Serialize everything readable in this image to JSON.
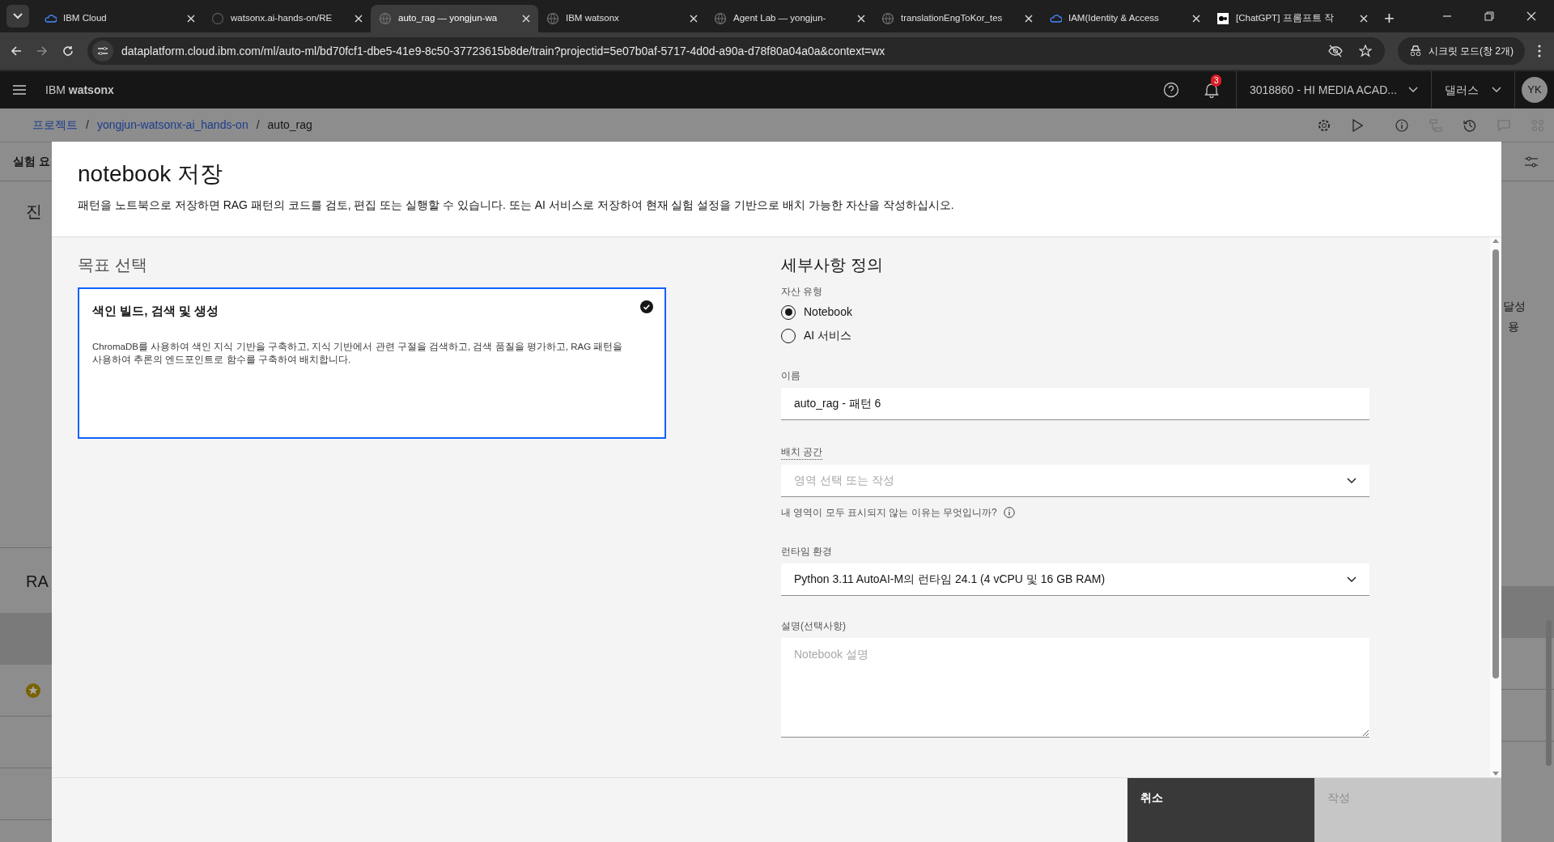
{
  "browser": {
    "tabs": [
      {
        "title": "IBM Cloud",
        "selected": false
      },
      {
        "title": "watsonx.ai-hands-on/RE",
        "selected": false
      },
      {
        "title": "auto_rag — yongjun-wa",
        "selected": true
      },
      {
        "title": "IBM watsonx",
        "selected": false
      },
      {
        "title": "Agent Lab — yongjun-",
        "selected": false
      },
      {
        "title": "translationEngToKor_tes",
        "selected": false
      },
      {
        "title": "IAM(Identity & Access",
        "selected": false
      },
      {
        "title": "[ChatGPT] 프롬프트 작",
        "selected": false
      }
    ],
    "new_tab": "+",
    "url": "dataplatform.cloud.ibm.com/ml/auto-ml/bd70fcf1-dbe5-41e9-8c50-37723615b8de/train?projectid=5e07b0af-5717-4d0d-a90a-d78f80a04a0a&context=wx",
    "profile": "시크릿 모드(창 2개)"
  },
  "app_header": {
    "brand": "IBM **watsonx**",
    "notification_count": "3",
    "account": "3018860 - HI MEDIA ACAD...",
    "region": "댈러스",
    "avatar": "YK"
  },
  "breadcrumb": {
    "items": [
      {
        "label": "프로젝트",
        "link": true
      },
      {
        "label": "yongjun-watsonx-ai_hands-on",
        "link": true
      },
      {
        "label": "auto_rag",
        "link": false
      }
    ],
    "separators": [
      "/",
      "/"
    ]
  },
  "background_page": {
    "left_texts": [
      "실험 요",
      "진",
      "RA"
    ],
    "right_texts": [
      "달성",
      "용"
    ]
  },
  "modal": {
    "title": "notebook 저장",
    "description": "패턴을 노트북으로 저장하면 RAG 패턴의 코드를 검토, 편집 또는 실행할 수 있습니다. 또는 AI 서비스로 저장하여 현재 실험 설정을 기반으로 배치 가능한 자산을 작성하십시오.",
    "goal_section": {
      "title": "목표 선택",
      "cards": [
        {
          "title": "색인 빌드, 검색 및 생성",
          "description": "ChromaDB를 사용하여 색인 지식 기반을 구축하고, 지식 기반에서 관련 구절을 검색하고, 검색 품질을 평가하고, RAG 패턴을 사용하여 추론의 엔드포인트로 함수를 구축하여 배치합니다.",
          "selected": true
        }
      ]
    },
    "details_section": {
      "title": "세부사항 정의",
      "asset_type": {
        "label": "자산 유형",
        "options": [
          {
            "label": "Notebook",
            "selected": true
          },
          {
            "label": "AI 서비스",
            "selected": false
          }
        ]
      },
      "name": {
        "label": "이름",
        "value": "auto_rag - 패턴 6"
      },
      "deployment_space": {
        "label": "배치 공간",
        "placeholder": "영역 선택 또는 작성",
        "help": "내 영역이 모두 표시되지 않는 이유는 무엇입니까?"
      },
      "runtime": {
        "label": "런타임 환경",
        "value": "Python 3.11 AutoAI-M의 런타임 24.1 (4 vCPU 및 16 GB RAM)"
      },
      "description": {
        "label": "설명(선택사항)",
        "placeholder": "Notebook 설명"
      }
    },
    "buttons": [
      {
        "label": "취소",
        "kind": "secondary",
        "disabled": false
      },
      {
        "label": "작성",
        "kind": "primary",
        "disabled": true
      }
    ]
  }
}
